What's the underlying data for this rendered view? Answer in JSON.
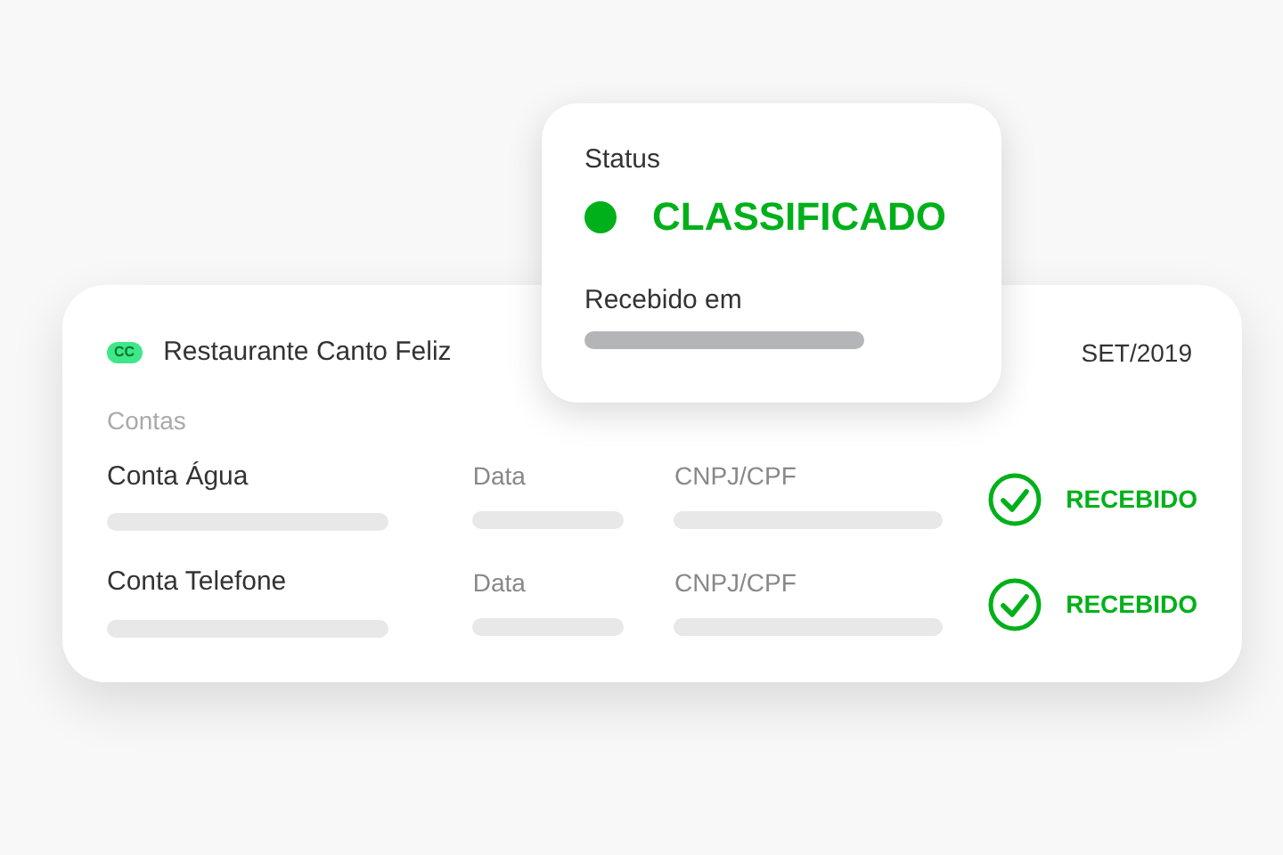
{
  "account": {
    "badge": "CC",
    "name": "Restaurante Canto Feliz",
    "period": "SET/2019"
  },
  "section_label": "Contas",
  "bills": [
    {
      "name": "Conta Água",
      "date_label": "Data",
      "doc_label": "CNPJ/CPF",
      "status": "RECEBIDO",
      "received": true
    },
    {
      "name": "Conta Telefone",
      "date_label": "Data",
      "doc_label": "CNPJ/CPF",
      "status": "RECEBIDO",
      "received": true
    }
  ],
  "status_popup": {
    "label": "Status",
    "value": "CLASSIFICADO",
    "color": "#00b01a",
    "received_label": "Recebido em"
  }
}
